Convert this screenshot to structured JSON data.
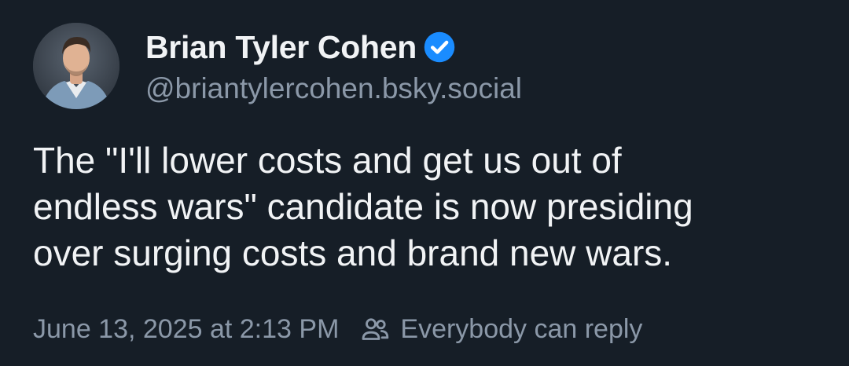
{
  "author": {
    "display_name": "Brian Tyler Cohen",
    "handle": "@briantylercohen.bsky.social",
    "verified": true,
    "verified_icon": "verified-check-badge-icon",
    "avatar_icon": "user-avatar-photo"
  },
  "post": {
    "text": "The \"I'll lower costs and get us out of\nendless wars\" candidate is now presiding\nover surging costs and brand new wars.",
    "timestamp": "June 13, 2025 at 2:13 PM",
    "reply_setting": "Everybody can reply",
    "reply_setting_icon": "people-icon"
  },
  "colors": {
    "background": "#161e27",
    "text": "#f1f3f5",
    "muted": "#8b98a8",
    "verified_blue": "#1a8cff"
  }
}
